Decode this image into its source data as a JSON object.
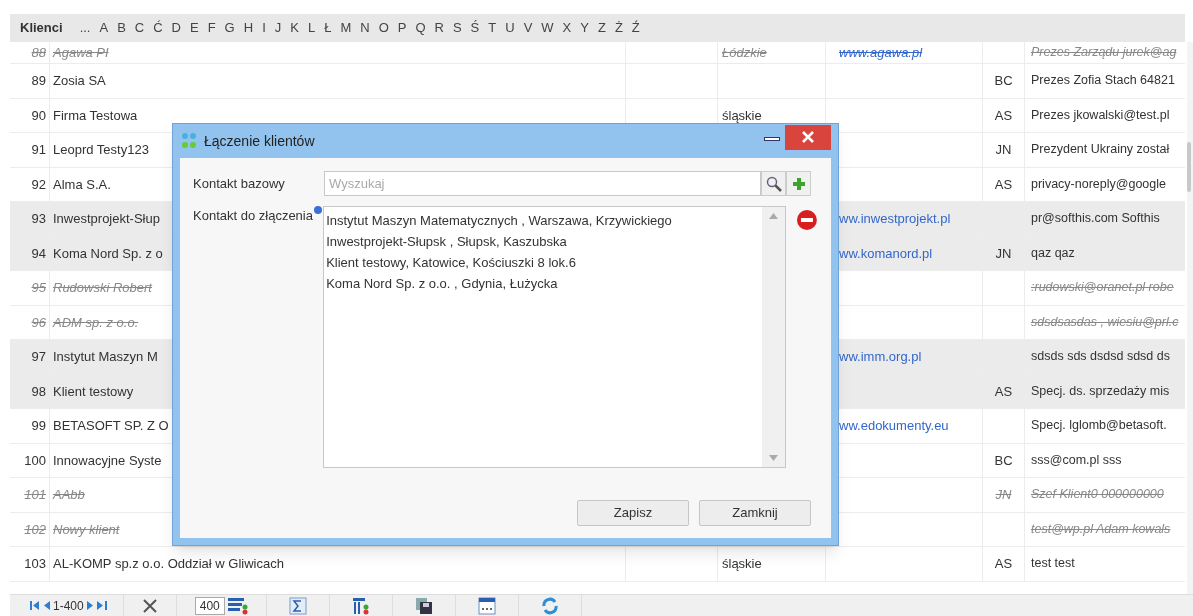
{
  "header": {
    "title": "Klienci",
    "letters": [
      "...",
      "A",
      "B",
      "C",
      "Ć",
      "D",
      "E",
      "F",
      "G",
      "H",
      "I",
      "J",
      "K",
      "L",
      "Ł",
      "M",
      "N",
      "O",
      "P",
      "Q",
      "R",
      "S",
      "Ś",
      "T",
      "U",
      "V",
      "W",
      "X",
      "Y",
      "Z",
      "Ż",
      "Ź"
    ]
  },
  "table": {
    "rows": [
      {
        "number": "88",
        "name": "Agawa PI",
        "region": "Łódzkie",
        "www": "www.agawa.pl",
        "initials": "",
        "description": "Prezes Zarządu jurek@ag",
        "deleted": true,
        "selected": false
      },
      {
        "number": "89",
        "name": "Zosia SA",
        "region": "",
        "www": "",
        "initials": "BC",
        "description": "Prezes Zofia Stach 64821",
        "deleted": false,
        "selected": false
      },
      {
        "number": "90",
        "name": "Firma Testowa",
        "region": "śląskie",
        "www": "",
        "initials": "AS",
        "description": "Prezes jkowalski@test.pl",
        "deleted": false,
        "selected": false
      },
      {
        "number": "91",
        "name": "Leoprd Testy123",
        "region": "",
        "www": "",
        "initials": "JN",
        "description": "Prezydent Ukrainy został",
        "deleted": false,
        "selected": false
      },
      {
        "number": "92",
        "name": "Alma S.A.",
        "region": "",
        "www": "",
        "initials": "AS",
        "description": "privacy-noreply@google",
        "deleted": false,
        "selected": false
      },
      {
        "number": "93",
        "name": "Inwestprojekt-Słup",
        "region": "",
        "www": "ww.inwestprojekt.pl",
        "initials": "",
        "description": "pr@softhis.com Softhis",
        "deleted": false,
        "selected": true
      },
      {
        "number": "94",
        "name": "Koma Nord Sp. z o",
        "region": "",
        "www": "ww.komanord.pl",
        "initials": "JN",
        "description": "qaz qaz",
        "deleted": false,
        "selected": true
      },
      {
        "number": "95",
        "name": "Rudowski Robert",
        "region": "",
        "www": "",
        "initials": "",
        "description": ":rudowski@oranet.pl robe",
        "deleted": true,
        "selected": false
      },
      {
        "number": "96",
        "name": "ADM sp. z o.o.",
        "region": "",
        "www": "",
        "initials": "",
        "description": "sdsdsasdas , wiesiu@prl.c",
        "deleted": true,
        "selected": false
      },
      {
        "number": "97",
        "name": "Instytut Maszyn M",
        "region": "",
        "www": "ww.imm.org.pl",
        "initials": "",
        "description": "sdsds sds dsdsd sdsd ds",
        "deleted": false,
        "selected": true
      },
      {
        "number": "98",
        "name": "Klient testowy",
        "region": "",
        "www": "",
        "initials": "AS",
        "description": "Specj. ds. sprzedaży mis",
        "deleted": false,
        "selected": true
      },
      {
        "number": "99",
        "name": "BETASOFT SP. Z O",
        "region": "",
        "www": "ww.edokumenty.eu",
        "initials": "",
        "description": "Specj. lglomb@betasoft.",
        "deleted": false,
        "selected": false
      },
      {
        "number": "100",
        "name": "Innowacyjne Syste",
        "region": "",
        "www": "",
        "initials": "BC",
        "description": "sss@com.pl sss",
        "deleted": false,
        "selected": false
      },
      {
        "number": "101",
        "name": "AAbb",
        "region": "",
        "www": "",
        "initials": "JN",
        "description": "Szef Klient0 000000000",
        "deleted": true,
        "selected": false
      },
      {
        "number": "102",
        "name": "Nowy klient",
        "region": "",
        "www": "",
        "initials": "",
        "description": "test@wp.pl Adam kowals",
        "deleted": true,
        "selected": false
      },
      {
        "number": "103",
        "name": "AL-KOMP sp.z o.o. Oddział w Gliwicach",
        "region": "śląskie",
        "www": "",
        "initials": "AS",
        "description": "test test",
        "deleted": false,
        "selected": false
      }
    ]
  },
  "footer": {
    "range": "1-400",
    "page_size": "400"
  },
  "dialog": {
    "title": "Łączenie klientów",
    "base_label": "Kontakt bazowy",
    "search_placeholder": "Wyszukaj",
    "merge_label": "Kontakt do złączenia",
    "merge_items": [
      "Instytut Maszyn Matematycznych , Warszawa, Krzywickiego",
      "Inwestprojekt-Słupsk , Słupsk, Kaszubska",
      "Klient testowy, Katowice, Kościuszki 8 lok.6",
      "Koma Nord Sp. z o.o. , Gdynia, Łużycka"
    ],
    "buttons": [
      "Zapisz",
      "Zamknij"
    ]
  }
}
